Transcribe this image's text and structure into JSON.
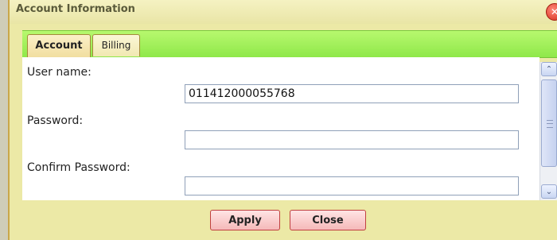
{
  "dialog": {
    "title": "Account Information",
    "close_icon": "close-icon",
    "close_glyph": "✕"
  },
  "tabs": [
    {
      "label": "Account",
      "active": true
    },
    {
      "label": "Billing",
      "active": false
    }
  ],
  "form": {
    "fields": [
      {
        "label": "User name:",
        "value": "011412000055768"
      },
      {
        "label": "Password:",
        "value": ""
      },
      {
        "label": "Confirm Password:",
        "value": ""
      }
    ]
  },
  "scrollbar": {
    "up_glyph": "⌃",
    "down_glyph": "⌄"
  },
  "footer": {
    "apply_label": "Apply",
    "close_label": "Close"
  },
  "colors": {
    "tab_bar": "#8fe84a",
    "dialog_bg": "#ece9a6",
    "button_bg": "#f5b9b9",
    "close_icon": "#d42a1a"
  }
}
